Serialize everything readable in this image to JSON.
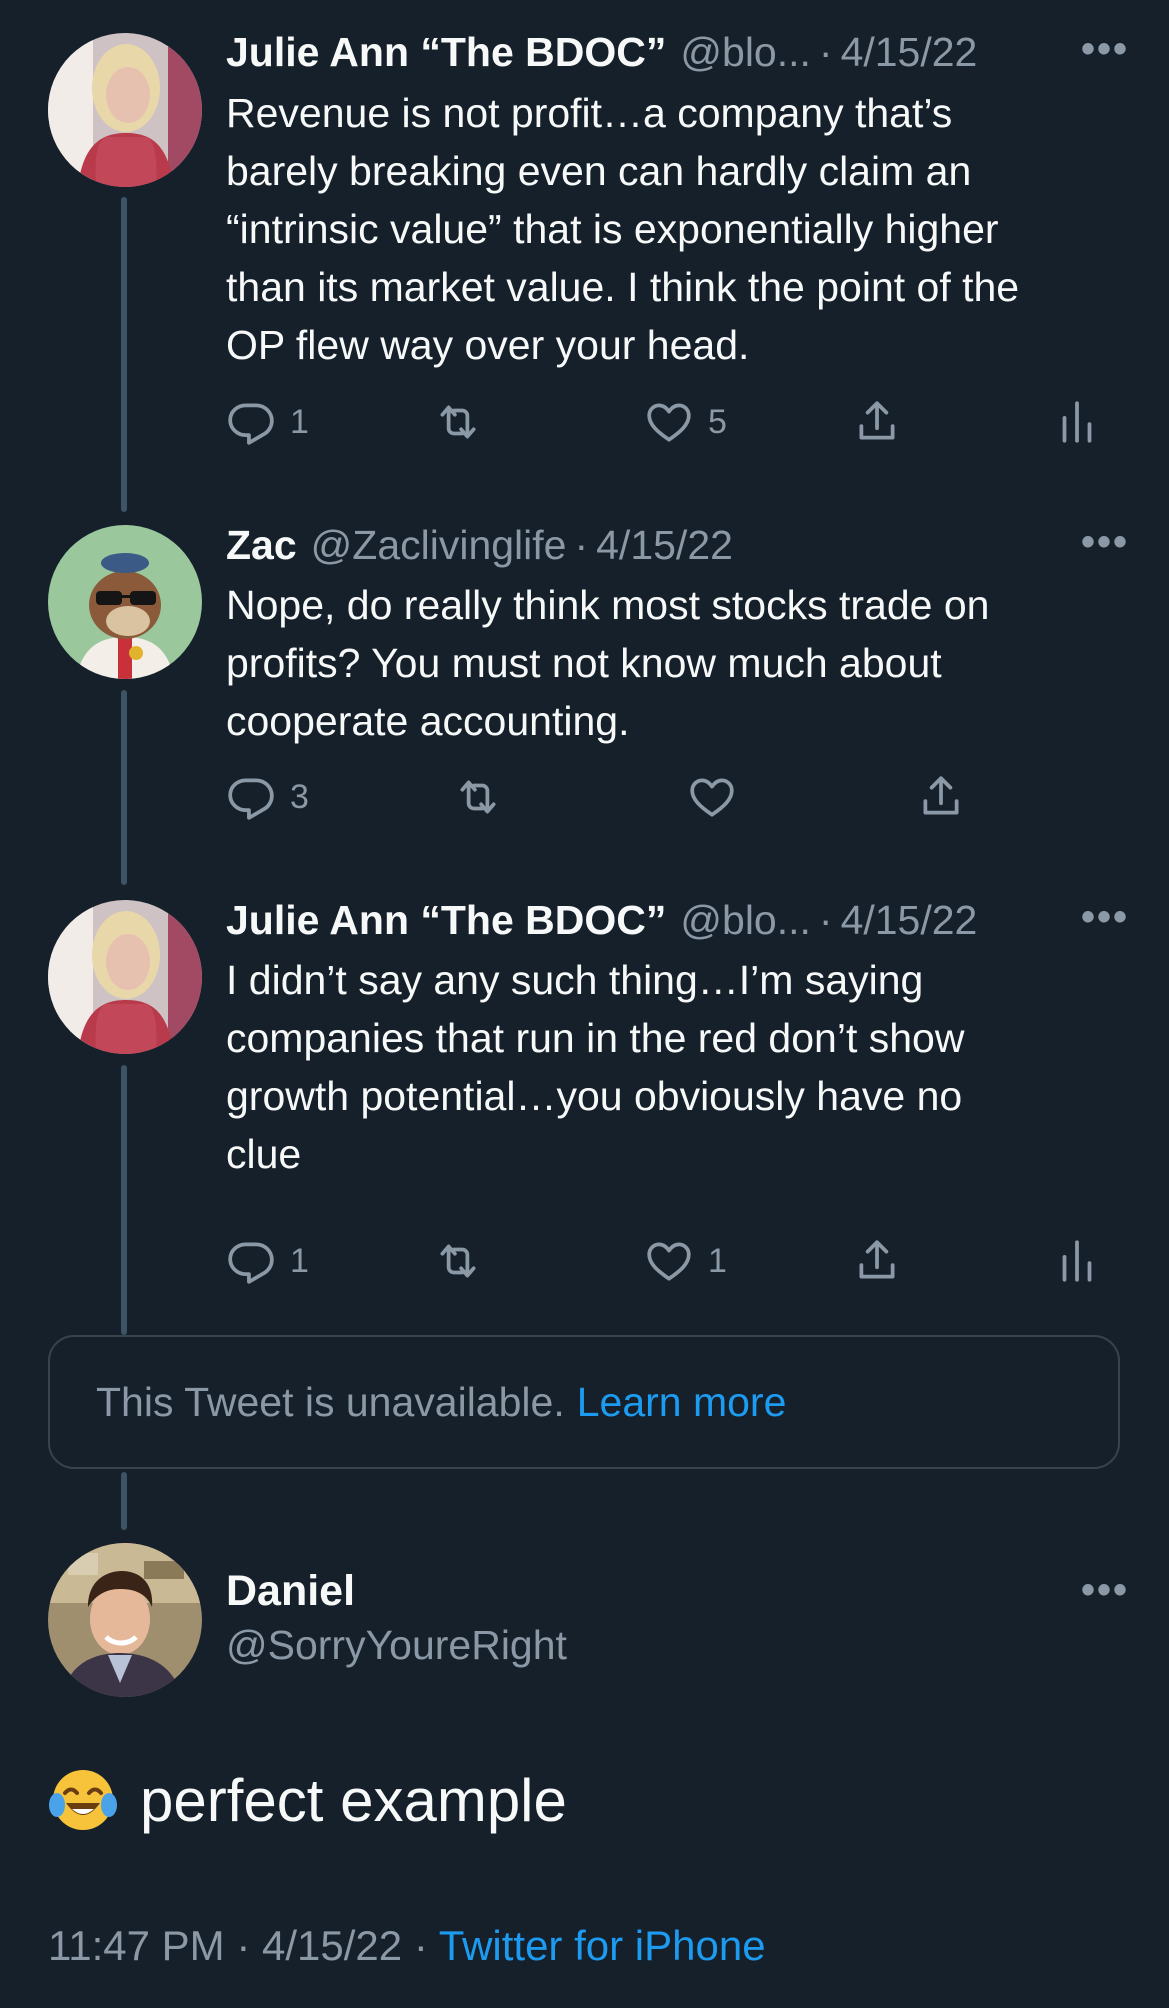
{
  "tweets": [
    {
      "name": "Julie Ann “The BDOC”",
      "handle": "@blo...",
      "date": "4/15/22",
      "lines": [
        "Revenue is not profit…a company that’s",
        "barely breaking even can hardly claim an",
        "“intrinsic value” that is exponentially higher",
        "than its market value. I think the point of the",
        "OP flew way over your head."
      ],
      "replies": "1",
      "likes": "5"
    },
    {
      "name": "Zac",
      "handle": "@Zaclivinglife",
      "date": "4/15/22",
      "lines": [
        "Nope, do really think most stocks trade on",
        "profits? You must not know much about",
        "cooperate accounting."
      ],
      "replies": "3"
    },
    {
      "name": "Julie Ann “The BDOC”",
      "handle": "@blo...",
      "date": "4/15/22",
      "lines": [
        "I didn’t say any such thing…I’m saying",
        "companies that run in the red don’t show",
        "growth potential…you obviously have no",
        "clue"
      ],
      "replies": "1",
      "likes": "1"
    }
  ],
  "unavailable": {
    "text": "This Tweet is unavailable.",
    "link": "Learn more"
  },
  "main_tweet": {
    "name": "Daniel",
    "handle": "@SorryYoureRight",
    "text": "perfect example",
    "time": "11:47 PM",
    "date": "4/15/22",
    "source": "Twitter for iPhone"
  },
  "separator": "·",
  "more_glyph": "•••",
  "icons": [
    "reply-icon",
    "retweet-icon",
    "like-icon",
    "share-icon",
    "analytics-icon",
    "more-icon",
    "tears-of-joy-emoji"
  ],
  "colors": {
    "background": "#15202b",
    "text": "#f7f9f9",
    "secondary": "#8b98a5",
    "link": "#1d9bf0",
    "thread_line": "#3d5466",
    "border": "#38444d"
  }
}
